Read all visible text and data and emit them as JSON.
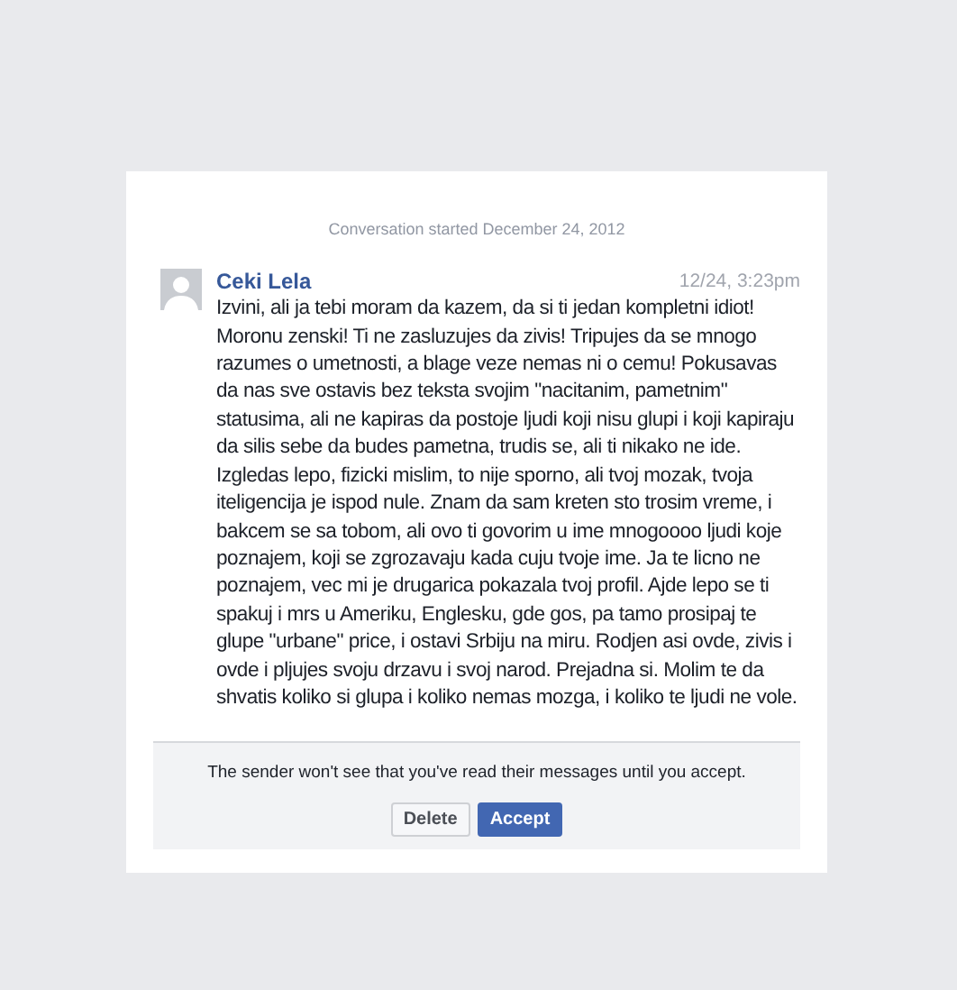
{
  "conversation_started": "Conversation started December 24, 2012",
  "message": {
    "sender": "Ceki Lela",
    "time": "12/24, 3:23pm",
    "text": "Izvini, ali ja tebi moram da kazem, da si ti jedan kompletni idiot! Moronu zenski! Ti ne zasluzujes da zivis! Tripujes da se mnogo razumes o umetnosti, a blage veze nemas ni o cemu! Pokusavas da nas sve ostavis bez teksta svojim \"nacitanim, pametnim\" statusima, ali ne kapiras da postoje ljudi koji nisu glupi i koji kapiraju da silis sebe da budes pametna, trudis se, ali ti nikako ne ide. Izgledas lepo, fizicki mislim, to nije sporno, ali tvoj mozak, tvoja iteligencija je ispod nule. Znam da sam kreten sto trosim vreme, i bakcem se sa tobom, ali ovo ti govorim u ime mnogoooo ljudi koje poznajem, koji se zgrozavaju kada cuju tvoje ime. Ja te licno ne poznajem, vec mi je drugarica pokazala tvoj profil. Ajde lepo se ti spakuj i mrs u Ameriku, Englesku, gde gos, pa tamo prosipaj te glupe \"urbane\" price, i ostavi Srbiju na miru. Rodjen asi ovde, zivis i  ovde i pljujes svoju drzavu i svoj narod. Prejadna si. Molim te da shvatis koliko si glupa i koliko nemas mozga, i koliko te ljudi ne vole."
  },
  "request_notice": "The sender won't see that you've read their messages until you accept.",
  "buttons": [
    {
      "label": "Delete",
      "kind": "secondary"
    },
    {
      "label": "Accept",
      "kind": "primary"
    }
  ]
}
